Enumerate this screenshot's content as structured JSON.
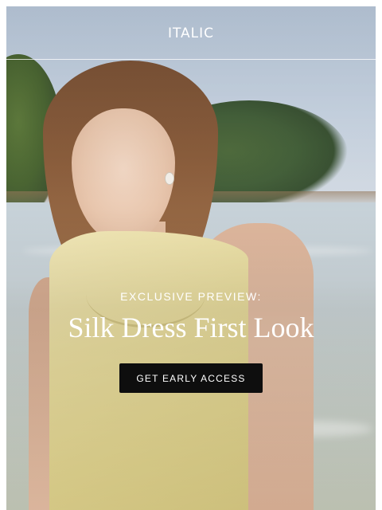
{
  "header": {
    "logo_text": "ITALIC"
  },
  "hero": {
    "eyebrow": "EXCLUSIVE PREVIEW:",
    "headline": "Silk Dress First Look",
    "cta_label": "GET EARLY ACCESS"
  },
  "colors": {
    "cta_background": "#0e0e0e",
    "text": "#ffffff",
    "dress": "#e8dc9f"
  }
}
